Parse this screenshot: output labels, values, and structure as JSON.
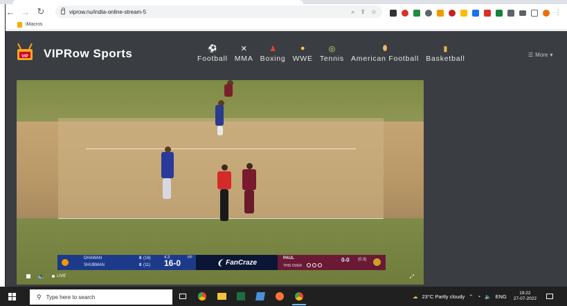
{
  "browser": {
    "url": "viprow.nu/india-online-stream-5",
    "bookmark_label": "iMacros",
    "colors": {
      "chrome_bg": "#dee1e6",
      "omnibox_bg": "#f1f3f4"
    }
  },
  "site": {
    "brand": "VIPRow Sports",
    "logo_text": "VIP",
    "nav": [
      {
        "label": "Football",
        "icon": "football-icon"
      },
      {
        "label": "MMA",
        "icon": "mma-icon"
      },
      {
        "label": "Boxing",
        "icon": "boxing-icon"
      },
      {
        "label": "WWE",
        "icon": "wwe-icon"
      },
      {
        "label": "Tennis",
        "icon": "tennis-icon"
      },
      {
        "label": "American Football",
        "icon": "american-football-icon"
      },
      {
        "label": "Basketball",
        "icon": "basketball-icon"
      }
    ],
    "more_label": "More",
    "colors": {
      "bg": "#3a3d42",
      "text": "#ffffff"
    }
  },
  "video": {
    "scoreboard": {
      "batter1_name": "DHAWAN",
      "batter1_score": "8",
      "batter1_balls": "(16)",
      "batter2_name": "SHUBMAN",
      "batter2_score": "8",
      "batter2_balls": "(11)",
      "overs": "4.3",
      "pp_label": "PP",
      "total": "16-0",
      "sponsor": "FanCraze",
      "bowler_name": "PAUL",
      "bowler_figures": "0-0",
      "bowler_overs": "(0.3)",
      "this_over_label": "THIS OVER"
    },
    "live_label": "LIVE"
  },
  "taskbar": {
    "search_placeholder": "Type here to search",
    "weather": "23°C  Partly cloudy",
    "language": "ENG",
    "time": "19:22",
    "date": "27-07-2022"
  }
}
